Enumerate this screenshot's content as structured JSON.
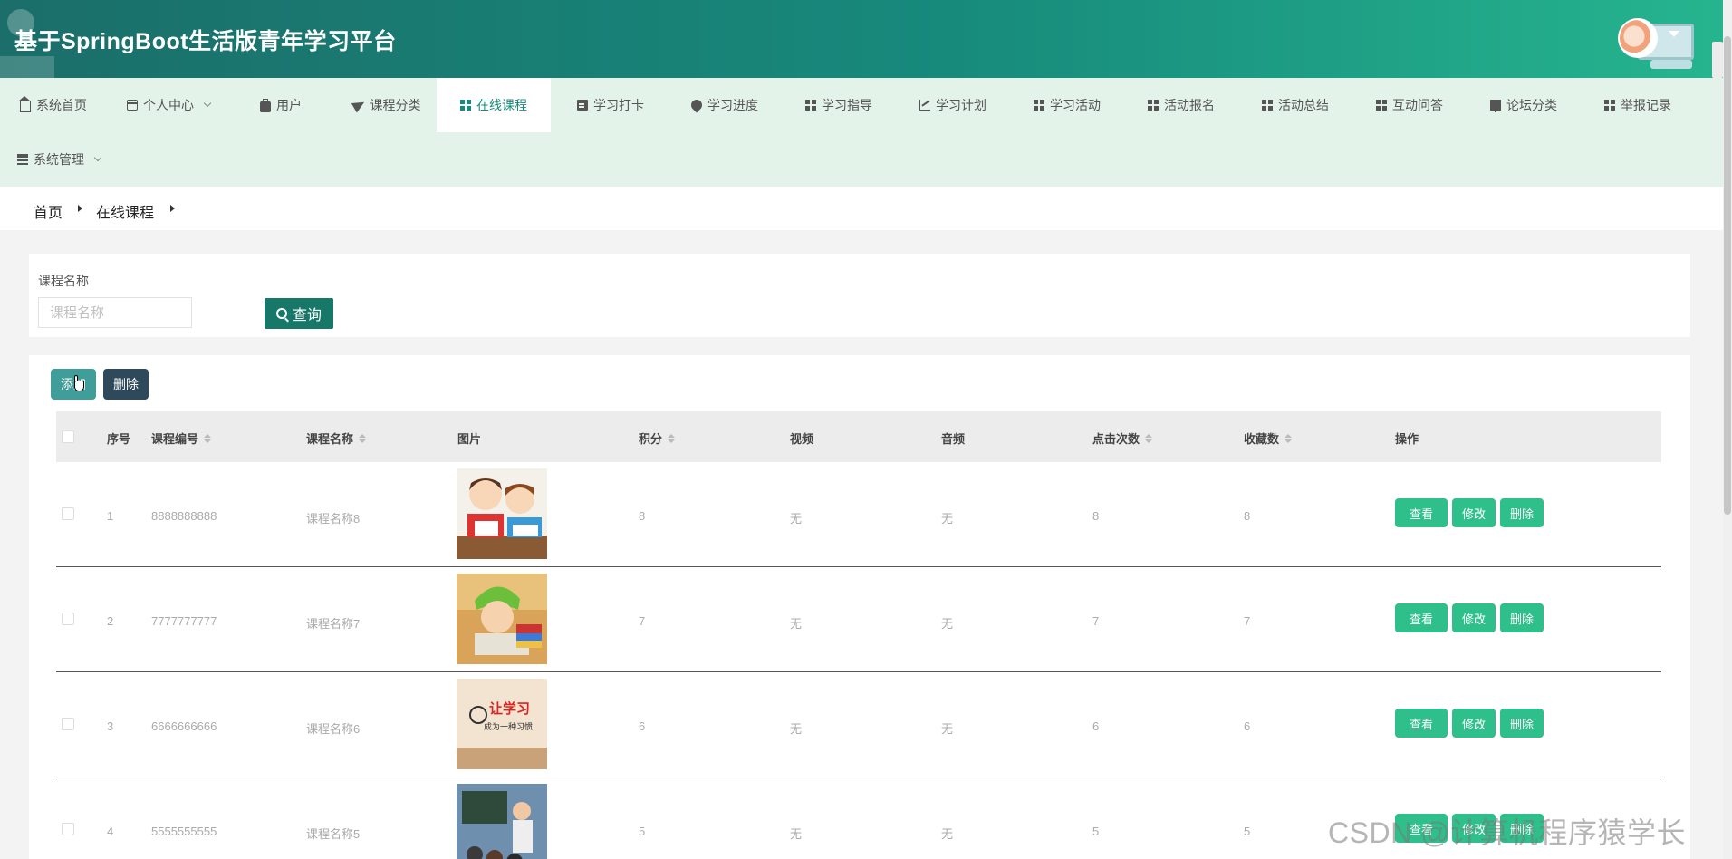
{
  "header": {
    "title": "基于SpringBoot生活版青年学习平台"
  },
  "nav": {
    "items": [
      {
        "label": "系统首页",
        "icon": "home-icon"
      },
      {
        "label": "个人中心",
        "icon": "card-icon",
        "dropdown": true
      },
      {
        "label": "用户",
        "icon": "briefcase-icon"
      },
      {
        "label": "课程分类",
        "icon": "paper-plane-icon"
      },
      {
        "label": "在线课程",
        "icon": "grid-icon",
        "active": true
      },
      {
        "label": "学习打卡",
        "icon": "clipboard-icon"
      },
      {
        "label": "学习进度",
        "icon": "pin-icon"
      },
      {
        "label": "学习指导",
        "icon": "grid-icon"
      },
      {
        "label": "学习计划",
        "icon": "chart-icon"
      },
      {
        "label": "学习活动",
        "icon": "grid-icon"
      },
      {
        "label": "活动报名",
        "icon": "grid-icon"
      },
      {
        "label": "活动总结",
        "icon": "grid-icon"
      },
      {
        "label": "互动问答",
        "icon": "grid-icon"
      },
      {
        "label": "论坛分类",
        "icon": "signpost-icon"
      },
      {
        "label": "举报记录",
        "icon": "grid-icon"
      },
      {
        "label": "系统管理",
        "icon": "sliders-icon",
        "dropdown": true
      }
    ]
  },
  "breadcrumb": [
    "首页",
    "在线课程"
  ],
  "search": {
    "label": "课程名称",
    "placeholder": "课程名称",
    "value": "",
    "button_label": "查询"
  },
  "toolbar": {
    "add_label": "添加",
    "delete_label": "删除"
  },
  "table": {
    "columns": [
      "序号",
      "课程编号",
      "课程名称",
      "图片",
      "积分",
      "视频",
      "音频",
      "点击次数",
      "收藏数",
      "操作"
    ],
    "rows": [
      {
        "index": "1",
        "code": "8888888888",
        "name": "课程名称8",
        "points": "8",
        "video": "无",
        "audio": "无",
        "clicks": "8",
        "favorites": "8"
      },
      {
        "index": "2",
        "code": "7777777777",
        "name": "课程名称7",
        "points": "7",
        "video": "无",
        "audio": "无",
        "clicks": "7",
        "favorites": "7"
      },
      {
        "index": "3",
        "code": "6666666666",
        "name": "课程名称6",
        "points": "6",
        "video": "无",
        "audio": "无",
        "clicks": "6",
        "favorites": "6"
      },
      {
        "index": "4",
        "code": "5555555555",
        "name": "课程名称5",
        "points": "5",
        "video": "无",
        "audio": "无",
        "clicks": "5",
        "favorites": "5"
      }
    ],
    "actions": {
      "view": "查看",
      "edit": "修改",
      "delete": "删除"
    }
  },
  "thumb_texts": {
    "row3_top": "让学习",
    "row3_bottom": "成为一种习惯"
  },
  "watermark": "CSDN @计算机程序猿学长",
  "colors": {
    "accent": "#178a7c",
    "nav_bg": "#e4f3e9",
    "action_green": "#2fbf8a",
    "delete_dark": "#2e4a5a"
  }
}
